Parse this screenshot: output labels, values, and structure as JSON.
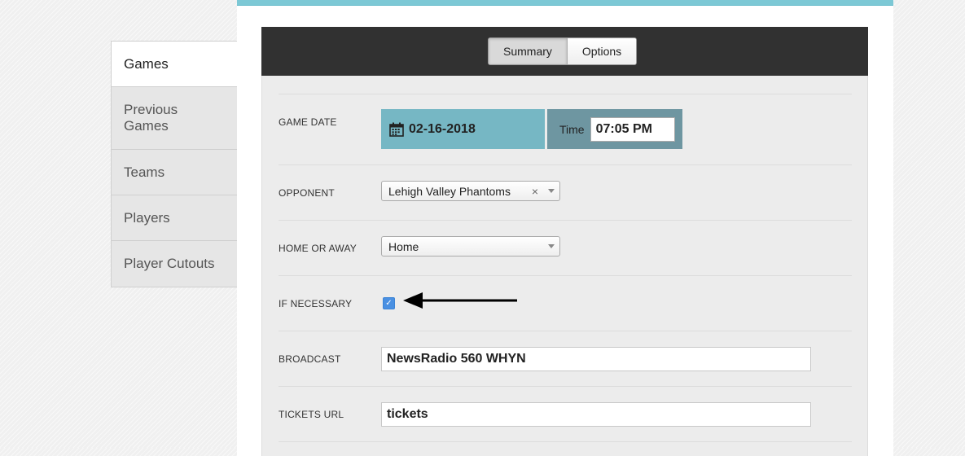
{
  "sidebar": {
    "items": [
      {
        "label": "Games"
      },
      {
        "label": "Previous Games"
      },
      {
        "label": "Teams"
      },
      {
        "label": "Players"
      },
      {
        "label": "Player Cutouts"
      }
    ]
  },
  "tabs": {
    "summary": "Summary",
    "options": "Options"
  },
  "form": {
    "game_date_label": "GAME DATE",
    "game_date_value": "02-16-2018",
    "time_label": "Time",
    "time_value": "07:05 PM",
    "opponent_label": "OPPONENT",
    "opponent_value": "Lehigh Valley Phantoms",
    "opponent_clear": "×",
    "home_away_label": "HOME OR AWAY",
    "home_away_value": "Home",
    "if_necessary_label": "IF NECESSARY",
    "if_necessary_checked": true,
    "if_necessary_mark": "✓",
    "broadcast_label": "BROADCAST",
    "broadcast_value": "NewsRadio 560 WHYN",
    "tickets_url_label": "TICKETS URL",
    "tickets_url_value": "tickets"
  },
  "colors": {
    "accent": "#7cc8d5",
    "date_block": "#76b7c4",
    "time_block": "#6e96a1",
    "dark_bar": "#313131",
    "checkbox": "#4a90e2"
  },
  "icons": {
    "calendar": "calendar-icon",
    "arrow": "arrow-left-icon"
  }
}
